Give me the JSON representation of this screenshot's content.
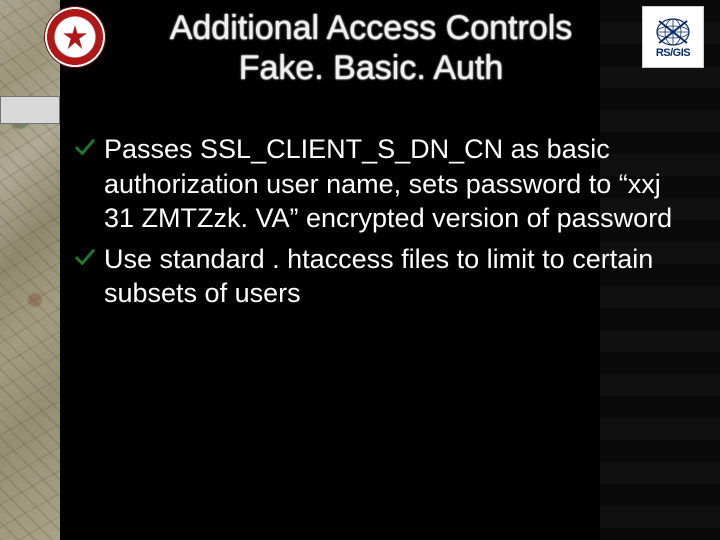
{
  "title_line1": "Additional Access Controls",
  "title_line2": "Fake. Basic. Auth",
  "title_combined": "Additional Access Controls Fake. Basic. Auth",
  "logos": {
    "left": "red-seal-crest",
    "right": "rsgis-globe",
    "right_text": "RS/GIS"
  },
  "map_strip_label": "",
  "bullets": [
    {
      "text": "Passes SSL_CLIENT_S_DN_CN as basic authorization user name, sets password to “xxj 31 ZMTZzk. VA” encrypted version of password"
    },
    {
      "text": "Use standard . htaccess files to limit to certain subsets of users"
    }
  ],
  "colors": {
    "background": "#000000",
    "body_text": "#ffffff",
    "checkmark": "#1a7a2a",
    "seal_red": "#b01818",
    "rsgis_blue": "#0a2a6a"
  }
}
